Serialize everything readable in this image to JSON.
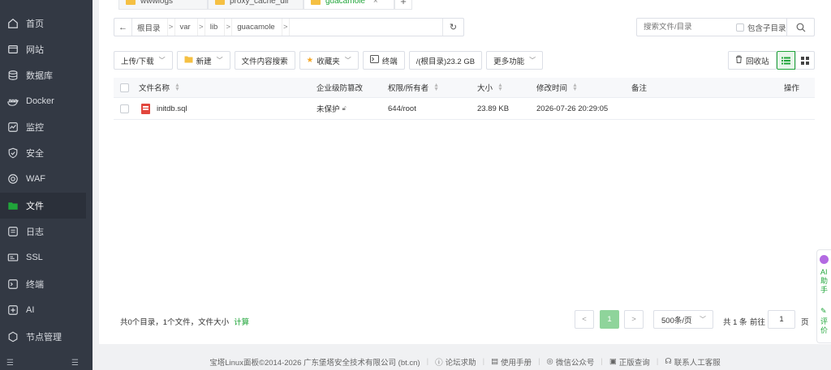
{
  "sidebar": {
    "items": [
      {
        "label": "首页",
        "icon": "home-icon",
        "active": false
      },
      {
        "label": "网站",
        "icon": "globe-icon",
        "active": false
      },
      {
        "label": "数据库",
        "icon": "database-icon",
        "active": false
      },
      {
        "label": "Docker",
        "icon": "docker-icon",
        "active": false
      },
      {
        "label": "监控",
        "icon": "monitor-icon",
        "active": false
      },
      {
        "label": "安全",
        "icon": "shield-icon",
        "active": false
      },
      {
        "label": "WAF",
        "icon": "waf-icon",
        "active": false
      },
      {
        "label": "文件",
        "icon": "folder-icon",
        "active": true
      },
      {
        "label": "日志",
        "icon": "log-icon",
        "active": false
      },
      {
        "label": "SSL",
        "icon": "ssl-icon",
        "active": false
      },
      {
        "label": "终端",
        "icon": "terminal-icon",
        "active": false
      },
      {
        "label": "AI",
        "icon": "ai-icon",
        "active": false
      },
      {
        "label": "节点管理",
        "icon": "node-icon",
        "active": false
      }
    ]
  },
  "tabs": [
    {
      "label": "wwwlogs",
      "active": false
    },
    {
      "label": "proxy_cache_dir",
      "active": false
    },
    {
      "label": "guacamole",
      "active": true
    }
  ],
  "tab_close": "×",
  "tab_add": "+",
  "path": {
    "back": "←",
    "crumbs": [
      "根目录",
      "var",
      "lib",
      "guacamole"
    ],
    "sep": ">",
    "refresh": "↻"
  },
  "search": {
    "placeholder": "搜索文件/目录",
    "include_sub": "包含子目录"
  },
  "toolbar": {
    "upload": "上传/下载",
    "new": "新建",
    "content_search": "文件内容搜索",
    "favorites": "收藏夹",
    "terminal": "终端",
    "disk": "/(根目录)23.2 GB",
    "more": "更多功能",
    "recycle": "回收站"
  },
  "table": {
    "headers": {
      "name": "文件名称",
      "protect": "企业级防篡改",
      "perm": "权限/所有者",
      "size": "大小",
      "mtime": "修改时间",
      "note": "备注",
      "ops": "操作"
    },
    "rows": [
      {
        "name": "initdb.sql",
        "protect": "未保护",
        "perm": "644/root",
        "size": "23.89 KB",
        "mtime": "2026-07-26 20:29:05",
        "note": ""
      }
    ]
  },
  "footer": {
    "summary": "共0个目录，1个文件，文件大小",
    "calc": "计算",
    "prev": "<",
    "page": "1",
    "next": ">",
    "per_page": "500条/页",
    "total": "共 1 条",
    "goto": "前往",
    "goto_value": "1",
    "page_unit": "页"
  },
  "page_footer": {
    "copyright": "宝塔Linux面板©2014-2026 广东堡塔安全技术有限公司 (bt.cn)",
    "links": [
      "论坛求助",
      "使用手册",
      "微信公众号",
      "正版查询",
      "联系人工客服"
    ]
  },
  "ai_float": {
    "ai": "AI助手",
    "rate": "评价"
  },
  "colors": {
    "accent": "#20a53a",
    "sidebar_bg": "#333944"
  }
}
